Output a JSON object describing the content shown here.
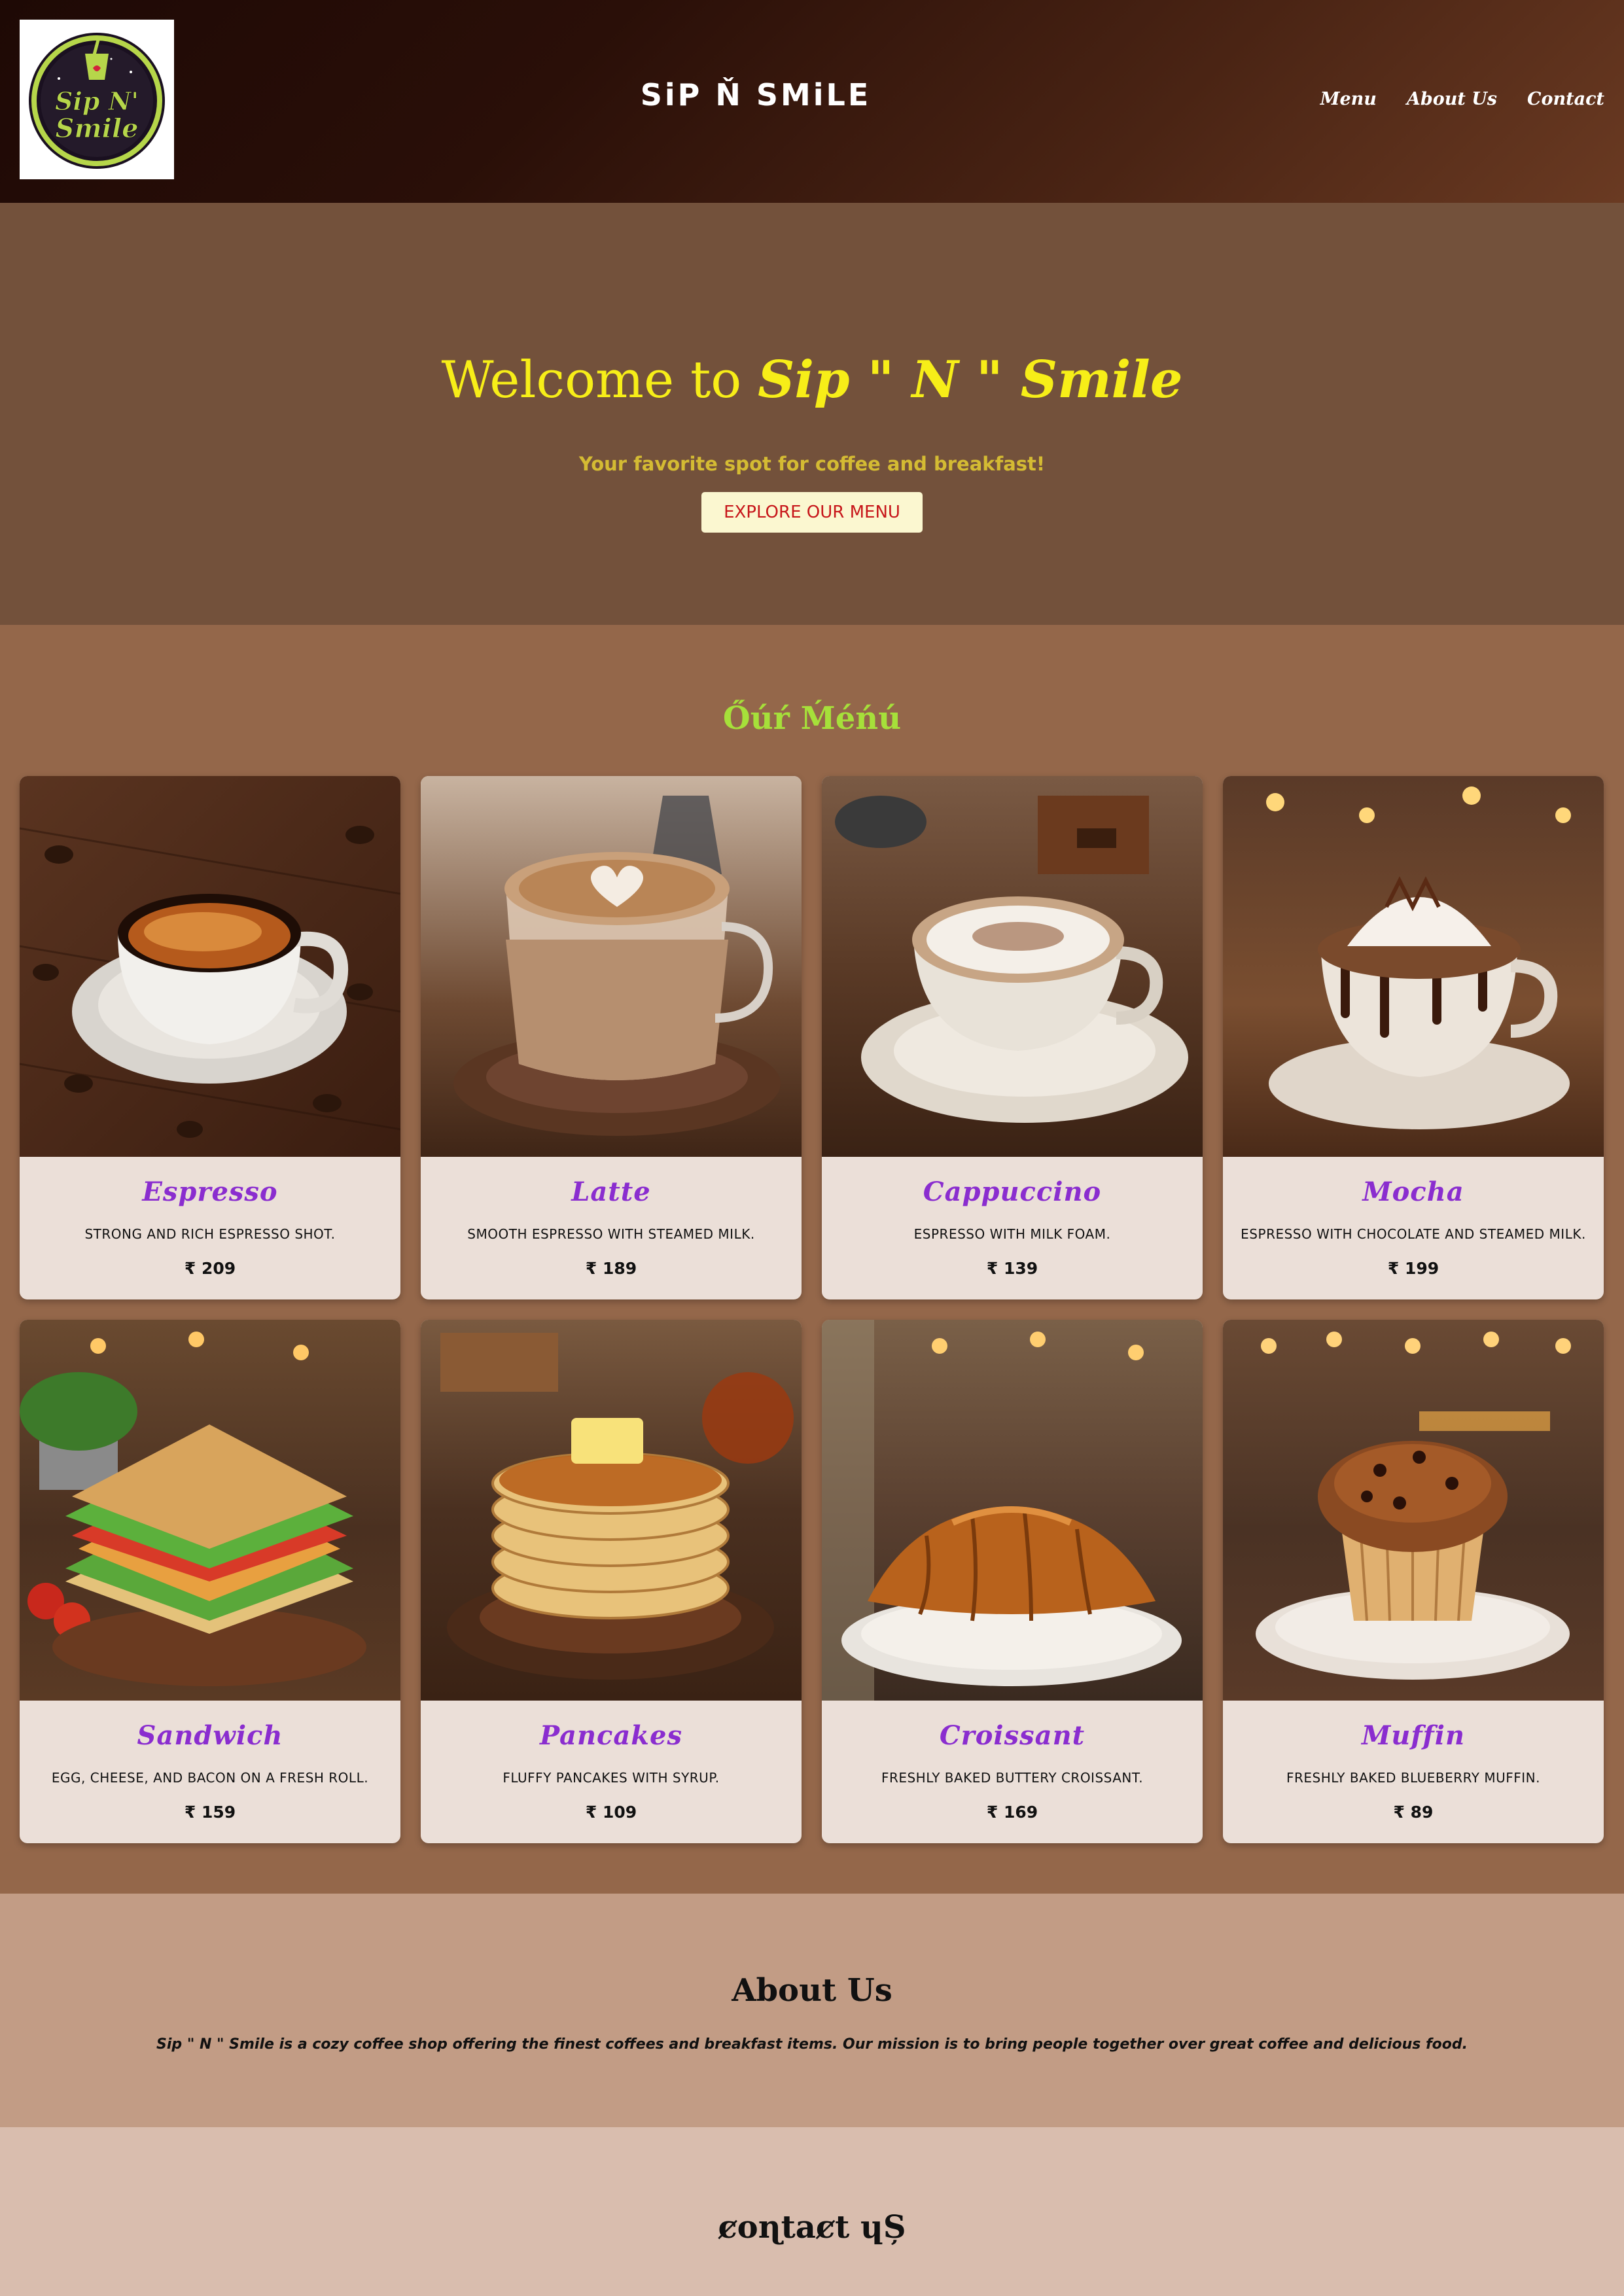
{
  "header": {
    "logo_text_1": "Sip N'",
    "logo_text_2": "Smile",
    "brand": "SiP Ň SMiLE",
    "nav": [
      "Menu",
      "About Us",
      "Contact"
    ]
  },
  "hero": {
    "title_prefix": "Welcome to ",
    "title_brand": "Sip \" N \" Smile",
    "tagline": "Your favorite spot for coffee and breakfast!",
    "cta_label": "EXPLORE OUR MENU"
  },
  "menu": {
    "heading": "Őúŕ Ḿéńú",
    "items": [
      {
        "name": "Espresso",
        "desc": "Strong and rich espresso shot.",
        "price": "₹ 209",
        "image": "espresso-photo"
      },
      {
        "name": "Latte",
        "desc": "Smooth espresso with steamed milk.",
        "price": "₹ 189",
        "image": "latte-photo"
      },
      {
        "name": "Cappuccino",
        "desc": "Espresso with milk foam.",
        "price": "₹ 139",
        "image": "cappuccino-photo"
      },
      {
        "name": "Mocha",
        "desc": "Espresso with chocolate and steamed milk.",
        "price": "₹ 199",
        "image": "mocha-photo"
      },
      {
        "name": "Sandwich",
        "desc": "Egg, cheese, and bacon on a fresh roll.",
        "price": "₹ 159",
        "image": "sandwich-photo"
      },
      {
        "name": "Pancakes",
        "desc": "Fluffy pancakes with syrup.",
        "price": "₹ 109",
        "image": "pancakes-photo"
      },
      {
        "name": "Croissant",
        "desc": "Freshly baked buttery croissant.",
        "price": "₹ 169",
        "image": "croissant-photo"
      },
      {
        "name": "Muffin",
        "desc": "Freshly baked blueberry muffin.",
        "price": "₹ 89",
        "image": "muffin-photo"
      }
    ]
  },
  "about": {
    "heading": "About Us",
    "text": "Sip \" N \" Smile is a cozy coffee shop offering the finest coffees and breakfast items. Our mission is to bring people together over great coffee and delicious food."
  },
  "contact": {
    "heading": "ȼoɳtaȼt ɥȘ"
  },
  "colors": {
    "header_dark": "#2a0f08",
    "hero_bg": "#73513b",
    "hero_title": "#f7ee18",
    "menu_bg": "#94674a",
    "menu_heading": "#a6e03a",
    "item_name": "#8a2dcf",
    "card_bg": "#ebdfd8",
    "about_bg": "#c29c85",
    "contact_bg": "#d9bdae",
    "cta_text": "#c7161a"
  }
}
